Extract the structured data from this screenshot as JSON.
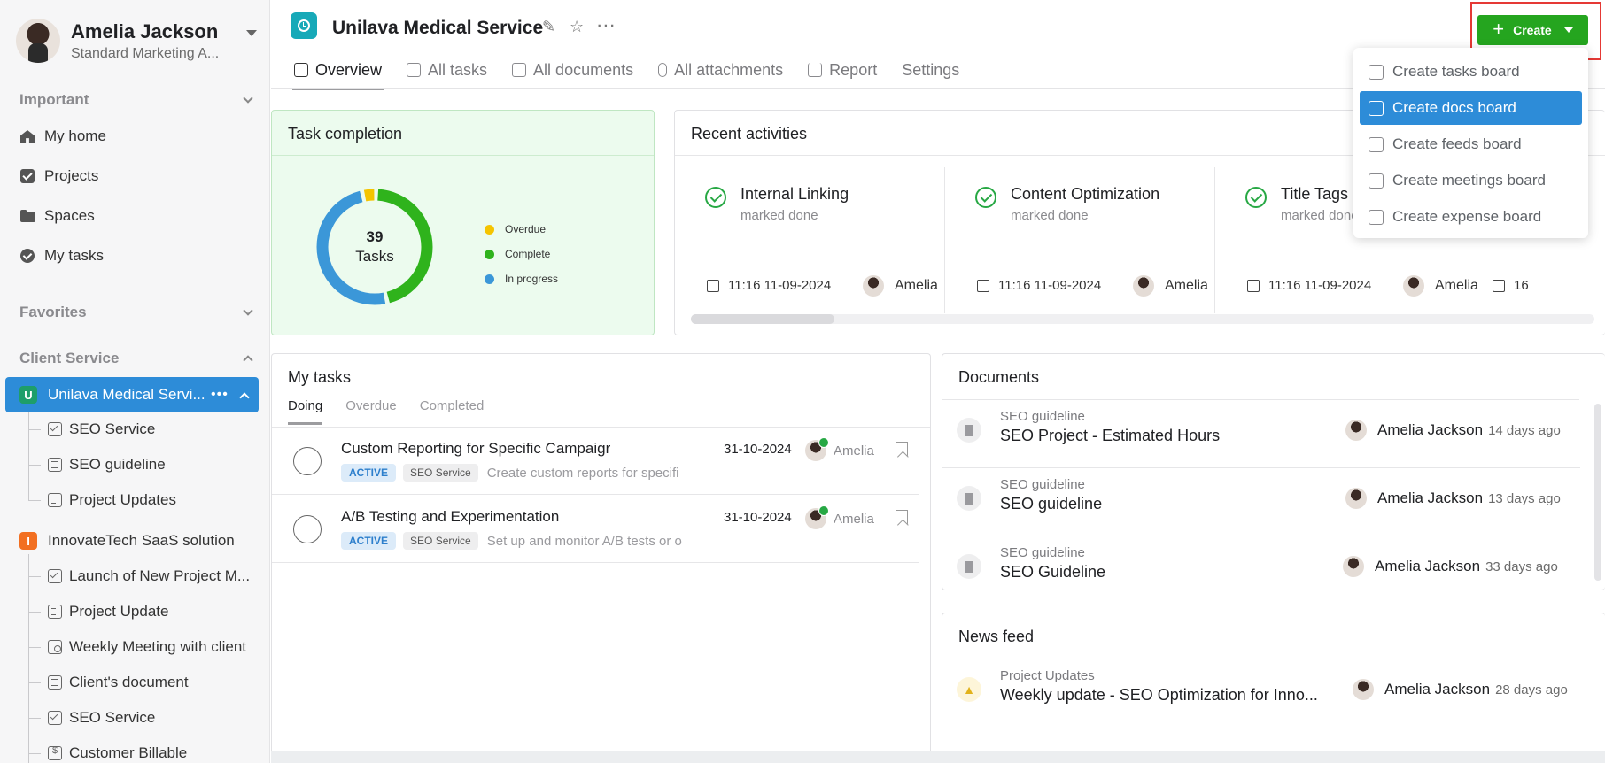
{
  "profile": {
    "name": "Amelia Jackson",
    "role": "Standard Marketing A..."
  },
  "sidebar": {
    "important_label": "Important",
    "nav": [
      {
        "label": "My home",
        "icon": "home-icon"
      },
      {
        "label": "Projects",
        "icon": "check-square-icon"
      },
      {
        "label": "Spaces",
        "icon": "folder-icon"
      },
      {
        "label": "My tasks",
        "icon": "check-circle-icon"
      }
    ],
    "favorites_label": "Favorites",
    "client_service_label": "Client Service",
    "spaces": [
      {
        "badge": "U",
        "badge_color": "#1e9e6a",
        "label": "Unilava Medical Servi...",
        "more": "•••",
        "children": [
          {
            "label": "SEO Service",
            "icon": "task-board-icon"
          },
          {
            "label": "SEO guideline",
            "icon": "doc-board-icon"
          },
          {
            "label": "Project Updates",
            "icon": "feed-board-icon"
          }
        ]
      },
      {
        "badge": "I",
        "badge_color": "#f26f21",
        "label": "InnovateTech SaaS solution",
        "children": [
          {
            "label": "Launch of New Project M...",
            "icon": "task-board-icon"
          },
          {
            "label": "Project Update",
            "icon": "feed-board-icon"
          },
          {
            "label": "Weekly Meeting with client",
            "icon": "meeting-board-icon"
          },
          {
            "label": "Client's document",
            "icon": "doc-board-icon"
          },
          {
            "label": "SEO Service",
            "icon": "task-board-icon"
          },
          {
            "label": "Customer Billable",
            "icon": "expense-board-icon"
          }
        ]
      }
    ]
  },
  "header": {
    "title": "Unilava Medical Service",
    "edit_icon": "✎",
    "star_icon": "☆",
    "more_icon": "⋯",
    "tabs": [
      "Overview",
      "All tasks",
      "All documents",
      "All attachments",
      "Report",
      "Settings"
    ],
    "create_plus": "+",
    "create_label": "Create"
  },
  "create_menu": [
    "Create tasks board",
    "Create docs board",
    "Create feeds board",
    "Create meetings board",
    "Create expense board"
  ],
  "task_completion": {
    "title": "Task completion",
    "total": "39",
    "total_label": "Tasks",
    "legend": [
      {
        "label": "Overdue",
        "color": "#f5c400"
      },
      {
        "label": "Complete",
        "color": "#2fb31c"
      },
      {
        "label": "In progress",
        "color": "#3b97d8"
      }
    ],
    "fractions": {
      "overdue": 0.04,
      "complete": 0.46,
      "in_progress": 0.5
    }
  },
  "recent": {
    "title": "Recent activities",
    "items": [
      {
        "title": "Internal Linking",
        "sub": "marked done",
        "time": "11:16 11-09-2024",
        "user": "Amelia"
      },
      {
        "title": "Content Optimization",
        "sub": "marked done",
        "time": "11:16 11-09-2024",
        "user": "Amelia"
      },
      {
        "title": "Title Tags",
        "sub": "marked done",
        "time": "11:16 11-09-2024",
        "user": "Amelia"
      },
      {
        "title": "",
        "sub": "",
        "time": "16",
        "user": ""
      }
    ]
  },
  "my_tasks": {
    "title": "My tasks",
    "tabs": [
      "Doing",
      "Overdue",
      "Completed"
    ],
    "rows": [
      {
        "title": "Custom Reporting for Specific Campaigr",
        "status": "ACTIVE",
        "space": "SEO Service",
        "desc": "Create custom reports for specifi",
        "date": "31-10-2024",
        "user": "Amelia"
      },
      {
        "title": "A/B Testing and Experimentation",
        "status": "ACTIVE",
        "space": "SEO Service",
        "desc": "Set up and monitor A/B tests or o",
        "date": "31-10-2024",
        "user": "Amelia"
      }
    ]
  },
  "documents": {
    "title": "Documents",
    "rows": [
      {
        "category": "SEO guideline",
        "name": "SEO Project - Estimated Hours",
        "user": "Amelia Jackson",
        "time": "14 days ago"
      },
      {
        "category": "SEO guideline",
        "name": "SEO guideline",
        "user": "Amelia Jackson",
        "time": "13 days ago"
      },
      {
        "category": "SEO guideline",
        "name": "SEO Guideline",
        "user": "Amelia Jackson",
        "time": "33 days ago"
      }
    ]
  },
  "news": {
    "title": "News feed",
    "rows": [
      {
        "category": "Project Updates",
        "name": "Weekly update - SEO Optimization for Inno...",
        "user": "Amelia Jackson",
        "time": "28 days ago"
      }
    ]
  }
}
